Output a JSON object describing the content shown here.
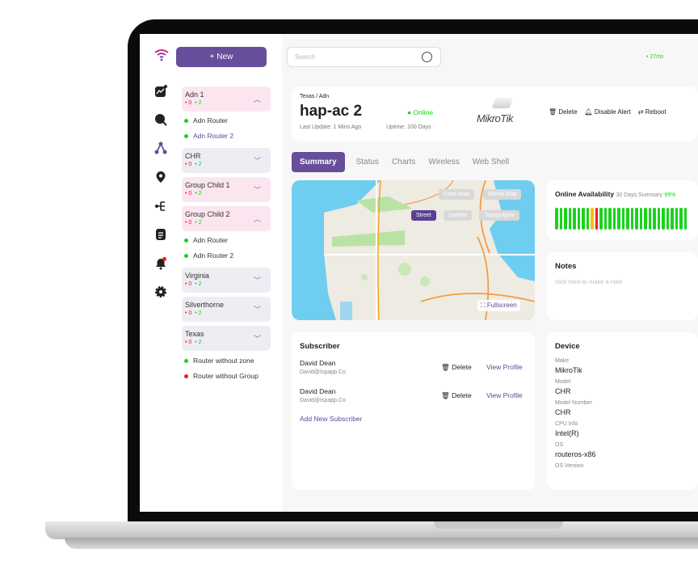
{
  "app": {
    "new_button": "+ New",
    "search_placeholder": "Search",
    "latency": "27ms"
  },
  "sidebar": {
    "nav_icons": [
      "chart-icon",
      "search-icon",
      "topology-icon",
      "location-icon",
      "hierarchy-icon",
      "report-icon",
      "bell-icon",
      "settings-icon"
    ],
    "groups": [
      {
        "name": "Adn 1",
        "down": "0",
        "up": "2",
        "expanded": true,
        "children": [
          {
            "name": "Adn Router",
            "status": "online"
          },
          {
            "name": "Adn Router 2",
            "status": "online",
            "selected": true
          }
        ]
      },
      {
        "name": "CHR",
        "down": "0",
        "up": "2",
        "expanded": false
      },
      {
        "name": "Group Child 1",
        "down": "0",
        "up": "2",
        "expanded": false
      },
      {
        "name": "Group Child 2",
        "down": "0",
        "up": "2",
        "expanded": true,
        "children": [
          {
            "name": "Adn Router",
            "status": "online"
          },
          {
            "name": "Adn Router 2",
            "status": "online"
          }
        ]
      },
      {
        "name": "Virginia",
        "down": "0",
        "up": "2",
        "expanded": false
      },
      {
        "name": "Silverthorne",
        "down": "0",
        "up": "2",
        "expanded": false
      },
      {
        "name": "Texas",
        "down": "0",
        "up": "2",
        "expanded": false
      }
    ],
    "ungrouped": [
      {
        "name": "Router without zone",
        "status": "online"
      },
      {
        "name": "Router without Group",
        "status": "offline"
      }
    ]
  },
  "device_header": {
    "breadcrumb": "Texas / Adn",
    "name": "hap-ac 2",
    "status": "Online",
    "last_update": "Last Update: 1 Mins Ago",
    "uptime": "Uptime: 100 Days",
    "brand": "MikroTik",
    "actions": [
      "Delete",
      "Disable Alert",
      "Reboot"
    ]
  },
  "tabs": [
    "Summary",
    "Status",
    "Charts",
    "Wireless",
    "Web Shell"
  ],
  "map": {
    "grow": "Grow Map",
    "shrink": "Shrink Map",
    "types": [
      "Street",
      "Satelite",
      "Topographic"
    ],
    "active_type": "Street",
    "fullscreen": "Fullscreen"
  },
  "availability": {
    "title": "Online Availability",
    "subtitle": "30 Days Summary",
    "percent": "99%",
    "days": [
      "up",
      "up",
      "up",
      "up",
      "up",
      "up",
      "up",
      "up",
      "partial",
      "down",
      "up",
      "up",
      "up",
      "up",
      "up",
      "up",
      "up",
      "up",
      "up",
      "up",
      "up",
      "up",
      "up",
      "up",
      "up",
      "up",
      "up",
      "up",
      "up",
      "up"
    ]
  },
  "notes": {
    "title": "Notes",
    "placeholder": "click here to make a note"
  },
  "subscriber": {
    "title": "Subscriber",
    "rows": [
      {
        "name": "David Dean",
        "email": "David@Ispapp.Co"
      },
      {
        "name": "David Dean",
        "email": "David@Ispapp.Co"
      }
    ],
    "delete": "Delete",
    "view": "View Profile",
    "add": "Add New Subscriber"
  },
  "device": {
    "title": "Device",
    "fields": [
      {
        "label": "Make",
        "value": "MikroTik"
      },
      {
        "label": "Model",
        "value": "CHR"
      },
      {
        "label": "Model Number",
        "value": "CHR"
      },
      {
        "label": "CPU Info",
        "value": "Intel(R)"
      },
      {
        "label": "OS",
        "value": "routeros-x86"
      },
      {
        "label": "OS Version",
        "value": ""
      }
    ]
  },
  "colors": {
    "accent": "#664e9b",
    "online": "#19d31e",
    "offline": "#f31b1b",
    "partial": "#f6c000"
  }
}
